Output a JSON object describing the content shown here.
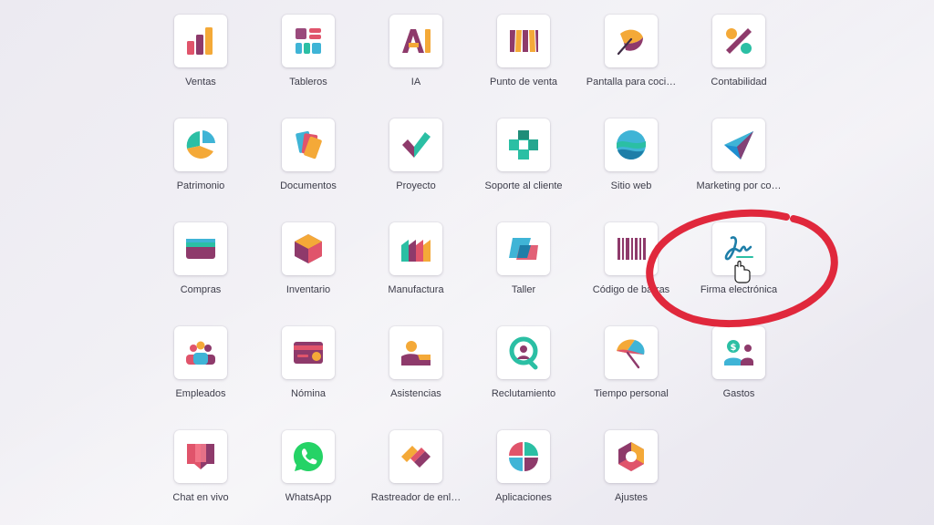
{
  "apps": [
    {
      "id": "ventas",
      "label": "Ventas",
      "icon": "sales-chart-icon"
    },
    {
      "id": "tableros",
      "label": "Tableros",
      "icon": "dashboard-icon"
    },
    {
      "id": "ia",
      "label": "IA",
      "icon": "ai-icon"
    },
    {
      "id": "punto-de-venta",
      "label": "Punto de venta",
      "icon": "shop-awning-icon"
    },
    {
      "id": "pantalla-cocina",
      "label": "Pantalla para coci…",
      "icon": "kitchen-feather-icon"
    },
    {
      "id": "contabilidad",
      "label": "Contabilidad",
      "icon": "percent-icon"
    },
    {
      "id": "patrimonio",
      "label": "Patrimonio",
      "icon": "pie-chart-icon"
    },
    {
      "id": "documentos",
      "label": "Documentos",
      "icon": "documents-icon"
    },
    {
      "id": "proyecto",
      "label": "Proyecto",
      "icon": "checkmark-icon"
    },
    {
      "id": "soporte",
      "label": "Soporte al cliente",
      "icon": "lifebuoy-cross-icon"
    },
    {
      "id": "sitio-web",
      "label": "Sitio web",
      "icon": "globe-waves-icon"
    },
    {
      "id": "marketing",
      "label": "Marketing por co…",
      "icon": "paper-plane-icon"
    },
    {
      "id": "compras",
      "label": "Compras",
      "icon": "credit-card-icon"
    },
    {
      "id": "inventario",
      "label": "Inventario",
      "icon": "cube-icon"
    },
    {
      "id": "manufactura",
      "label": "Manufactura",
      "icon": "factory-icon"
    },
    {
      "id": "taller",
      "label": "Taller",
      "icon": "workshop-card-icon"
    },
    {
      "id": "codigo-barras",
      "label": "Código de barras",
      "icon": "barcode-icon"
    },
    {
      "id": "firma",
      "label": "Firma electrónica",
      "icon": "signature-icon"
    },
    {
      "id": "empleados",
      "label": "Empleados",
      "icon": "employees-icon"
    },
    {
      "id": "nomina",
      "label": "Nómina",
      "icon": "payroll-card-icon"
    },
    {
      "id": "asistencias",
      "label": "Asistencias",
      "icon": "attendance-icon"
    },
    {
      "id": "reclutamiento",
      "label": "Reclutamiento",
      "icon": "recruitment-icon"
    },
    {
      "id": "tiempo-personal",
      "label": "Tiempo personal",
      "icon": "umbrella-icon"
    },
    {
      "id": "gastos",
      "label": "Gastos",
      "icon": "expenses-icon"
    },
    {
      "id": "chat",
      "label": "Chat en vivo",
      "icon": "chat-bubbles-icon"
    },
    {
      "id": "whatsapp",
      "label": "WhatsApp",
      "icon": "whatsapp-icon"
    },
    {
      "id": "rastreador",
      "label": "Rastreador de enl…",
      "icon": "link-tracker-icon"
    },
    {
      "id": "aplicaciones",
      "label": "Aplicaciones",
      "icon": "apps-quadrant-icon"
    },
    {
      "id": "ajustes",
      "label": "Ajustes",
      "icon": "settings-hexagon-icon"
    }
  ],
  "highlight": {
    "app": "Firma electrónica",
    "color": "#e0283c"
  },
  "cursor": {
    "icon": "hand-pointer-icon"
  }
}
